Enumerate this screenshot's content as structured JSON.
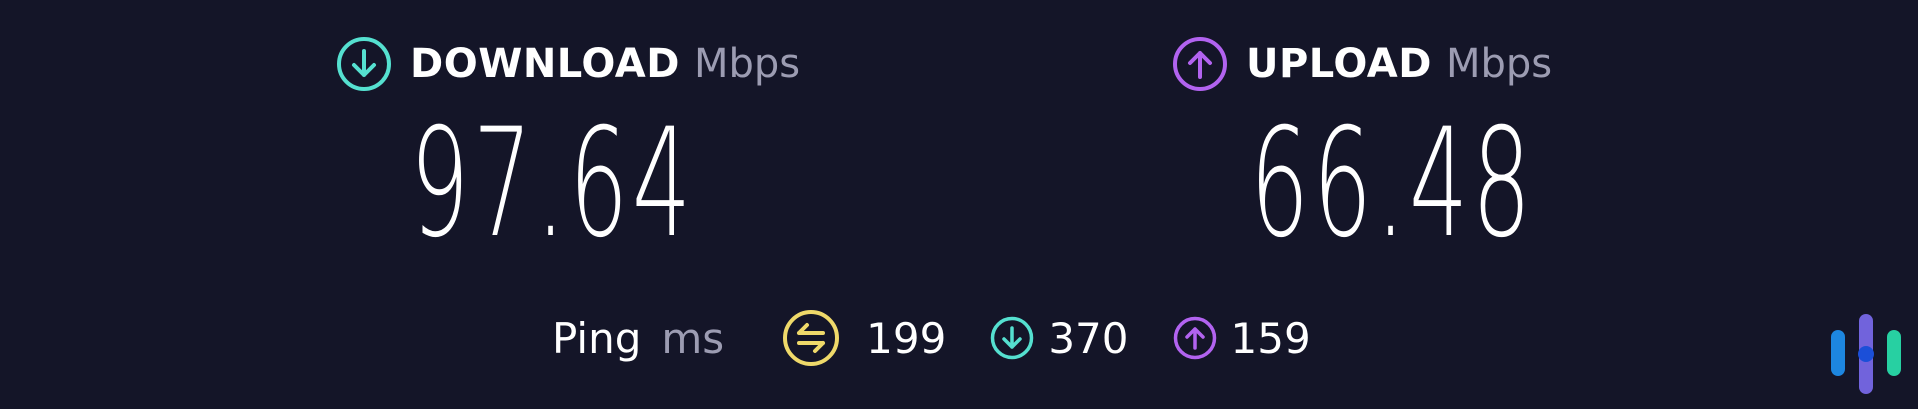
{
  "download": {
    "label": "DOWNLOAD",
    "unit": "Mbps",
    "value": "97.64",
    "icon": "arrow-down-circle-icon",
    "color": "#55e0d0"
  },
  "upload": {
    "label": "UPLOAD",
    "unit": "Mbps",
    "value": "66.48",
    "icon": "arrow-up-circle-icon",
    "color": "#b263f0"
  },
  "ping": {
    "label": "Ping",
    "unit": "ms",
    "idle": {
      "value": "199",
      "icon": "ping-idle-icon",
      "color": "#efd96a"
    },
    "download": {
      "value": "370",
      "icon": "arrow-down-circle-icon",
      "color": "#55e0d0"
    },
    "upload": {
      "value": "159",
      "icon": "arrow-up-circle-icon",
      "color": "#b263f0"
    }
  },
  "colors": {
    "background": "#141528",
    "text": "#ffffff",
    "muted": "#9c9cb2"
  },
  "brand": {
    "icon": "brand-logo-icon"
  }
}
